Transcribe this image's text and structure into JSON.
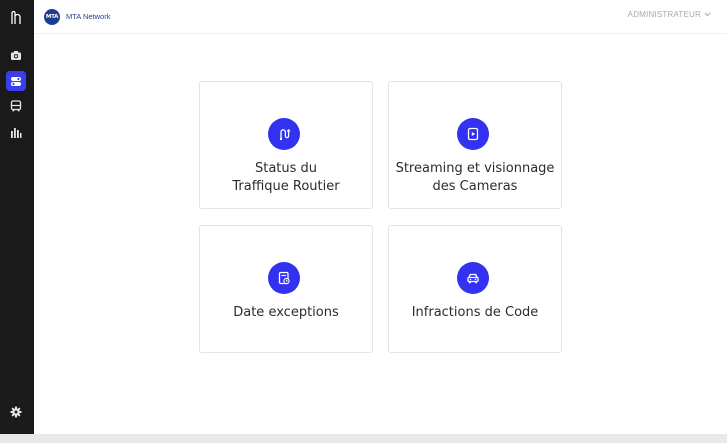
{
  "app": {
    "logo_text": "MTA",
    "brand": "MTA Network"
  },
  "header": {
    "user_menu_label": "ADMINISTRATEUR"
  },
  "sidebar": {
    "items": [
      {
        "name": "home",
        "icon": "app-logo-icon"
      },
      {
        "name": "cameras",
        "icon": "camera-icon"
      },
      {
        "name": "dashboard",
        "icon": "toggle-panel-icon",
        "active": true
      },
      {
        "name": "transport",
        "icon": "bus-icon"
      },
      {
        "name": "statistics",
        "icon": "bar-chart-icon"
      },
      {
        "name": "settings",
        "icon": "gear-icon"
      }
    ]
  },
  "cards": [
    {
      "label": "Status du\nTraffique Routier",
      "icon": "route-icon"
    },
    {
      "label": "Streaming et visionnage\ndes Cameras",
      "icon": "video-file-icon"
    },
    {
      "label": "Date exceptions",
      "icon": "calendar-doc-icon"
    },
    {
      "label": "Infractions de Code",
      "icon": "car-icon"
    }
  ],
  "colors": {
    "accent": "#3232f0",
    "sidebar_bg": "#1a1a1a",
    "brand": "#1f3d8f"
  }
}
